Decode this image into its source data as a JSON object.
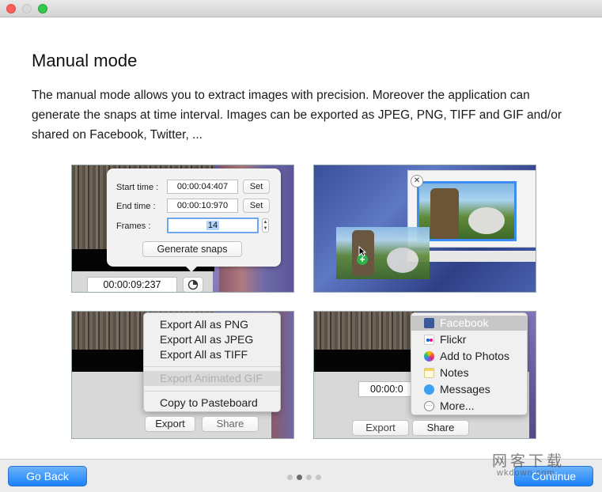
{
  "window": {
    "title": "",
    "heading": "Manual mode",
    "description": "The manual mode allows you to extract images with precision. Moreover the application can generate the snaps at time interval. Images can be exported as JPEG, PNG, TIFF and GIF and/or shared on Facebook, Twitter, ..."
  },
  "screenshot1": {
    "start_label": "Start time :",
    "start_value": "00:00:04:407",
    "end_label": "End time :",
    "end_value": "00:00:10:970",
    "set_label": "Set",
    "frames_label": "Frames :",
    "frames_value": "14",
    "generate_label": "Generate snaps",
    "timecode": "00:00:09:237"
  },
  "screenshot2": {
    "close_glyph": "✕",
    "add_glyph": "+"
  },
  "screenshot3": {
    "menu": [
      "Export All as PNG",
      "Export All as JPEG",
      "Export All as TIFF",
      "Export Animated GIF",
      "Copy to Pasteboard"
    ],
    "export_label": "Export",
    "share_label": "Share"
  },
  "screenshot4": {
    "timecode": "00:00:0",
    "share_menu": [
      "Facebook",
      "Flickr",
      "Add to Photos",
      "Notes",
      "Messages",
      "More..."
    ],
    "export_label": "Export",
    "share_label": "Share"
  },
  "footer": {
    "back_label": "Go Back",
    "continue_label": "Continue",
    "page_dots": 4,
    "active_dot": 2,
    "watermark": "网客下载",
    "watermark_url": "wkdown.com"
  },
  "colors": {
    "accent": "#1a82fb",
    "facebook": "#3b5998",
    "close_light": "#fc605b",
    "zoom_light": "#34c84a"
  }
}
